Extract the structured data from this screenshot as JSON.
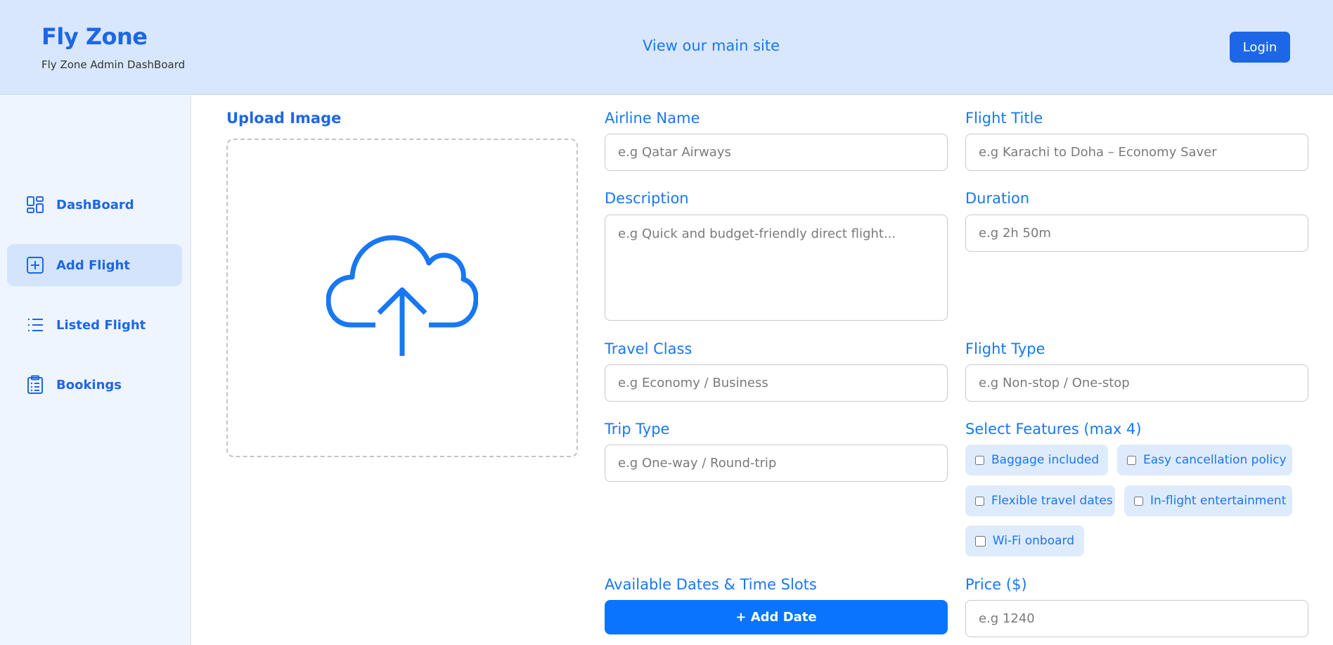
{
  "header": {
    "brand_title": "Fly Zone",
    "brand_subtitle": "Fly Zone Admin DashBoard",
    "main_site_link": "View our main site",
    "login_label": "Login"
  },
  "sidebar": {
    "items": [
      {
        "label": "DashBoard",
        "icon": "dashboard-grid-icon",
        "active": false
      },
      {
        "label": "Add Flight",
        "icon": "plus-square-icon",
        "active": true
      },
      {
        "label": "Listed Flight",
        "icon": "list-icon",
        "active": false
      },
      {
        "label": "Bookings",
        "icon": "clipboard-icon",
        "active": false
      }
    ]
  },
  "upload": {
    "title": "Upload Image",
    "icon": "cloud-upload-icon"
  },
  "form": {
    "airline_name": {
      "label": "Airline Name",
      "placeholder": "e.g Qatar Airways"
    },
    "flight_title": {
      "label": "Flight Title",
      "placeholder": "e.g Karachi to Doha – Economy Saver"
    },
    "description": {
      "label": "Description",
      "placeholder": "e.g Quick and budget-friendly direct flight..."
    },
    "duration": {
      "label": "Duration",
      "placeholder": "e.g 2h 50m"
    },
    "travel_class": {
      "label": "Travel Class",
      "placeholder": "e.g Economy / Business"
    },
    "flight_type": {
      "label": "Flight Type",
      "placeholder": "e.g Non-stop / One-stop"
    },
    "trip_type": {
      "label": "Trip Type",
      "placeholder": "e.g One-way / Round-trip"
    },
    "features": {
      "label": "Select Features (max 4)",
      "options": [
        {
          "label": "Baggage included",
          "checked": false
        },
        {
          "label": "Easy cancellation policy",
          "checked": false
        },
        {
          "label": "Flexible travel dates",
          "checked": false
        },
        {
          "label": "In-flight entertainment",
          "checked": false
        },
        {
          "label": "Wi-Fi onboard",
          "checked": false
        }
      ]
    },
    "dates": {
      "label": "Available Dates & Time Slots",
      "add_button": "+ Add Date"
    },
    "price": {
      "label": "Price ($)",
      "placeholder": "e.g 1240"
    }
  },
  "colors": {
    "header_bg": "#d8e7fd",
    "sidebar_bg": "#eef5fe",
    "accent": "#1877f2",
    "brand": "#1d67e6",
    "active_item_bg": "#d3e4fc",
    "chip_bg": "#deebfc"
  }
}
